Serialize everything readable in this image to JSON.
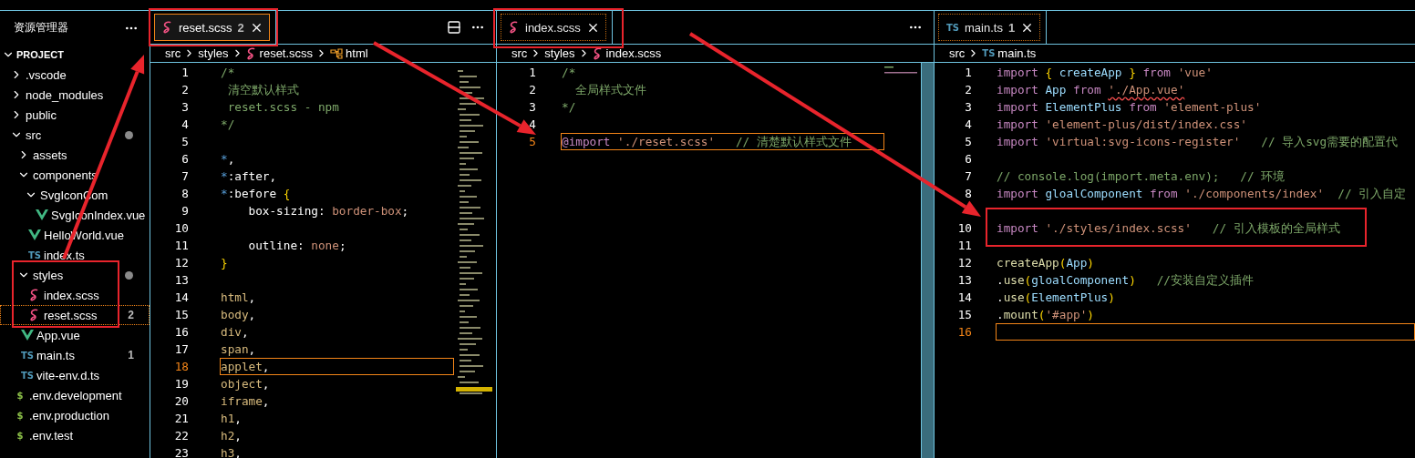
{
  "sidebar": {
    "title": "资源管理器",
    "section": "PROJECT",
    "tree": [
      {
        "name": ".vscode",
        "kind": "folder",
        "expanded": false,
        "modified": false,
        "selected": false
      },
      {
        "name": "node_modules",
        "kind": "folder",
        "expanded": false,
        "modified": false,
        "selected": false
      },
      {
        "name": "public",
        "kind": "folder",
        "expanded": false,
        "modified": false,
        "selected": false
      },
      {
        "name": "src",
        "kind": "folder",
        "expanded": true,
        "modified": true,
        "selected": false,
        "children": [
          {
            "name": "assets",
            "kind": "folder",
            "expanded": false,
            "modified": false,
            "selected": false
          },
          {
            "name": "components",
            "kind": "folder",
            "expanded": true,
            "modified": false,
            "selected": false,
            "children": [
              {
                "name": "SvgIconCom",
                "kind": "folder",
                "expanded": true,
                "modified": false,
                "selected": false,
                "children": [
                  {
                    "name": "SvgIconIndex.vue",
                    "kind": "vue",
                    "selected": false
                  }
                ]
              },
              {
                "name": "HelloWorld.vue",
                "kind": "vue",
                "selected": false
              },
              {
                "name": "index.ts",
                "kind": "ts",
                "icon_text": "TS",
                "selected": false
              }
            ]
          },
          {
            "name": "styles",
            "kind": "folder",
            "expanded": true,
            "modified": true,
            "selected": false,
            "children": [
              {
                "name": "index.scss",
                "kind": "scss",
                "selected": false
              },
              {
                "name": "reset.scss",
                "kind": "scss",
                "problems": "2",
                "selected": true
              }
            ]
          },
          {
            "name": "App.vue",
            "kind": "vue",
            "selected": false
          },
          {
            "name": "main.ts",
            "kind": "ts",
            "icon_text": "TS",
            "problems": "1",
            "selected": false
          },
          {
            "name": "vite-env.d.ts",
            "kind": "ts",
            "icon_text": "TS",
            "selected": false
          }
        ]
      },
      {
        "name": ".env.development",
        "kind": "env",
        "icon_text": "$",
        "selected": false
      },
      {
        "name": ".env.production",
        "kind": "env",
        "icon_text": "$",
        "selected": false
      },
      {
        "name": ".env.test",
        "kind": "env",
        "icon_text": "$",
        "selected": false
      }
    ]
  },
  "editors": [
    {
      "tab": {
        "label": "reset.scss",
        "kind": "scss",
        "problems": "2",
        "focused": true
      },
      "breadcrumb": [
        {
          "text": "src",
          "kind": "folder"
        },
        {
          "text": "styles",
          "kind": "folder"
        },
        {
          "text": "reset.scss",
          "kind": "scss"
        },
        {
          "text": "html",
          "kind": "symbol"
        }
      ],
      "actions": [
        {
          "kind": "split"
        },
        {
          "kind": "more"
        }
      ],
      "lines": [
        {
          "number": "1",
          "current": false,
          "tokens": [
            {
              "text": "/*",
              "kind": "comment"
            }
          ]
        },
        {
          "number": "2",
          "current": false,
          "tokens": [
            {
              "text": " 清空默认样式",
              "kind": "comment"
            }
          ]
        },
        {
          "number": "3",
          "current": false,
          "tokens": [
            {
              "text": " reset.scss - npm",
              "kind": "comment"
            }
          ]
        },
        {
          "number": "4",
          "current": false,
          "tokens": [
            {
              "text": "*/",
              "kind": "comment"
            }
          ]
        },
        {
          "number": "5",
          "current": false
        },
        {
          "number": "6",
          "current": false,
          "tokens": [
            {
              "text": "*",
              "kind": "star"
            },
            {
              "text": ",",
              "kind": "plain"
            }
          ]
        },
        {
          "number": "7",
          "current": false,
          "tokens": [
            {
              "text": "*",
              "kind": "star"
            },
            {
              "text": ":after,",
              "kind": "plain"
            }
          ]
        },
        {
          "number": "8",
          "current": false,
          "tokens": [
            {
              "text": "*",
              "kind": "star"
            },
            {
              "text": ":before ",
              "kind": "plain"
            },
            {
              "text": "{",
              "kind": "brace"
            }
          ]
        },
        {
          "number": "9",
          "current": false,
          "tokens": [
            {
              "text": "    box-sizing: ",
              "kind": "plain"
            },
            {
              "text": "border-box",
              "kind": "value"
            },
            {
              "text": ";",
              "kind": "plain"
            }
          ]
        },
        {
          "number": "10",
          "current": false
        },
        {
          "number": "11",
          "current": false,
          "tokens": [
            {
              "text": "    outline: ",
              "kind": "plain"
            },
            {
              "text": "none",
              "kind": "value"
            },
            {
              "text": ";",
              "kind": "plain"
            }
          ]
        },
        {
          "number": "12",
          "current": false,
          "tokens": [
            {
              "text": "}",
              "kind": "brace"
            }
          ]
        },
        {
          "number": "13",
          "current": false
        },
        {
          "number": "14",
          "current": false,
          "tokens": [
            {
              "text": "html",
              "kind": "tag"
            },
            {
              "text": ",",
              "kind": "plain"
            }
          ]
        },
        {
          "number": "15",
          "current": false,
          "tokens": [
            {
              "text": "body",
              "kind": "tag"
            },
            {
              "text": ",",
              "kind": "plain"
            }
          ]
        },
        {
          "number": "16",
          "current": false,
          "tokens": [
            {
              "text": "div",
              "kind": "tag"
            },
            {
              "text": ",",
              "kind": "plain"
            }
          ]
        },
        {
          "number": "17",
          "current": false,
          "tokens": [
            {
              "text": "span",
              "kind": "tag"
            },
            {
              "text": ",",
              "kind": "plain"
            }
          ]
        },
        {
          "number": "18",
          "current": true,
          "tokens": [
            {
              "text": "applet",
              "kind": "tag"
            },
            {
              "text": ",",
              "kind": "plain"
            }
          ]
        },
        {
          "number": "19",
          "current": false,
          "tokens": [
            {
              "text": "object",
              "kind": "tag"
            },
            {
              "text": ",",
              "kind": "plain"
            }
          ]
        },
        {
          "number": "20",
          "current": false,
          "tokens": [
            {
              "text": "iframe",
              "kind": "tag"
            },
            {
              "text": ",",
              "kind": "plain"
            }
          ]
        },
        {
          "number": "21",
          "current": false,
          "tokens": [
            {
              "text": "h1",
              "kind": "tag"
            },
            {
              "text": ",",
              "kind": "plain"
            }
          ]
        },
        {
          "number": "22",
          "current": false,
          "tokens": [
            {
              "text": "h2",
              "kind": "tag"
            },
            {
              "text": ",",
              "kind": "plain"
            }
          ]
        },
        {
          "number": "23",
          "current": false,
          "tokens": [
            {
              "text": "h3",
              "kind": "tag"
            },
            {
              "text": ",",
              "kind": "plain"
            }
          ]
        }
      ]
    },
    {
      "tab": {
        "label": "index.scss",
        "kind": "scss",
        "focused": false
      },
      "breadcrumb": [
        {
          "text": "src",
          "kind": "folder"
        },
        {
          "text": "styles",
          "kind": "folder"
        },
        {
          "text": "index.scss",
          "kind": "scss"
        }
      ],
      "actions": [
        {
          "kind": "more"
        }
      ],
      "lines": [
        {
          "number": "1",
          "current": false,
          "tokens": [
            {
              "text": "/*",
              "kind": "comment"
            }
          ]
        },
        {
          "number": "2",
          "current": false,
          "tokens": [
            {
              "text": "  全局样式文件",
              "kind": "comment"
            }
          ]
        },
        {
          "number": "3",
          "current": false,
          "tokens": [
            {
              "text": "*/",
              "kind": "comment"
            }
          ]
        },
        {
          "number": "4",
          "current": false
        },
        {
          "number": "5",
          "current": true,
          "tokens": [
            {
              "text": "@import ",
              "kind": "keyword"
            },
            {
              "text": "'./reset.scss'",
              "kind": "string"
            },
            {
              "text": "   // 清楚默认样式文件",
              "kind": "comment"
            }
          ]
        }
      ]
    },
    {
      "tab": {
        "label": "main.ts",
        "kind": "ts",
        "icon_text": "TS",
        "problems": "1",
        "focused": false
      },
      "breadcrumb": [
        {
          "text": "src",
          "kind": "folder"
        },
        {
          "text": "main.ts",
          "kind": "ts",
          "icon_text": "TS"
        }
      ],
      "lines": [
        {
          "number": "1",
          "current": false,
          "tokens": [
            {
              "text": "import ",
              "kind": "keyword"
            },
            {
              "text": "{",
              "kind": "brace"
            },
            {
              "text": " createApp ",
              "kind": "ident"
            },
            {
              "text": "}",
              "kind": "brace"
            },
            {
              "text": " from ",
              "kind": "keyword"
            },
            {
              "text": "'vue'",
              "kind": "string"
            }
          ]
        },
        {
          "number": "2",
          "current": false,
          "tokens": [
            {
              "text": "import",
              "kind": "keyword"
            },
            {
              "text": " App ",
              "kind": "ident"
            },
            {
              "text": "from ",
              "kind": "keyword"
            },
            {
              "text": "'./App.vue'",
              "kind": "string",
              "error": true
            }
          ]
        },
        {
          "number": "3",
          "current": false,
          "tokens": [
            {
              "text": "import",
              "kind": "keyword"
            },
            {
              "text": " ElementPlus ",
              "kind": "ident"
            },
            {
              "text": "from ",
              "kind": "keyword"
            },
            {
              "text": "'element-plus'",
              "kind": "string"
            }
          ]
        },
        {
          "number": "4",
          "current": false,
          "tokens": [
            {
              "text": "import ",
              "kind": "keyword"
            },
            {
              "text": "'element-plus/dist/index.css'",
              "kind": "string"
            }
          ]
        },
        {
          "number": "5",
          "current": false,
          "tokens": [
            {
              "text": "import ",
              "kind": "keyword"
            },
            {
              "text": "'virtual:svg-icons-register'",
              "kind": "string"
            },
            {
              "text": "   // 导入svg需要的配置代",
              "kind": "comment"
            }
          ]
        },
        {
          "number": "6",
          "current": false
        },
        {
          "number": "7",
          "current": false,
          "tokens": [
            {
              "text": "// console.log(import.meta.env);   // 环境",
              "kind": "comment"
            }
          ]
        },
        {
          "number": "8",
          "current": false,
          "tokens": [
            {
              "text": "import",
              "kind": "keyword"
            },
            {
              "text": " gloalComponent ",
              "kind": "ident"
            },
            {
              "text": "from ",
              "kind": "keyword"
            },
            {
              "text": "'./components/index'",
              "kind": "string"
            },
            {
              "text": "  // 引入自定",
              "kind": "comment"
            }
          ]
        },
        {
          "current": false
        },
        {
          "number": "10",
          "current": false,
          "tokens": [
            {
              "text": "import ",
              "kind": "keyword"
            },
            {
              "text": "'./styles/index.scss'",
              "kind": "string"
            },
            {
              "text": "   // 引入模板的全局样式",
              "kind": "comment"
            }
          ]
        },
        {
          "number": "11",
          "current": false
        },
        {
          "number": "12",
          "current": false,
          "tokens": [
            {
              "text": "createApp",
              "kind": "func"
            },
            {
              "text": "(",
              "kind": "brace"
            },
            {
              "text": "App",
              "kind": "ident"
            },
            {
              "text": ")",
              "kind": "brace"
            }
          ]
        },
        {
          "number": "13",
          "current": false,
          "tokens": [
            {
              "text": ".",
              "kind": "plain"
            },
            {
              "text": "use",
              "kind": "func"
            },
            {
              "text": "(",
              "kind": "brace"
            },
            {
              "text": "gloalComponent",
              "kind": "ident"
            },
            {
              "text": ")",
              "kind": "brace"
            },
            {
              "text": "   //安装自定义插件",
              "kind": "comment"
            }
          ]
        },
        {
          "number": "14",
          "current": false,
          "tokens": [
            {
              "text": ".",
              "kind": "plain"
            },
            {
              "text": "use",
              "kind": "func"
            },
            {
              "text": "(",
              "kind": "brace"
            },
            {
              "text": "ElementPlus",
              "kind": "ident"
            },
            {
              "text": ")",
              "kind": "brace"
            }
          ]
        },
        {
          "number": "15",
          "current": false,
          "tokens": [
            {
              "text": ".",
              "kind": "plain"
            },
            {
              "text": "mount",
              "kind": "func"
            },
            {
              "text": "(",
              "kind": "brace"
            },
            {
              "text": "'#app'",
              "kind": "string"
            },
            {
              "text": ")",
              "kind": "brace"
            }
          ]
        },
        {
          "number": "16",
          "current": true
        }
      ]
    }
  ]
}
